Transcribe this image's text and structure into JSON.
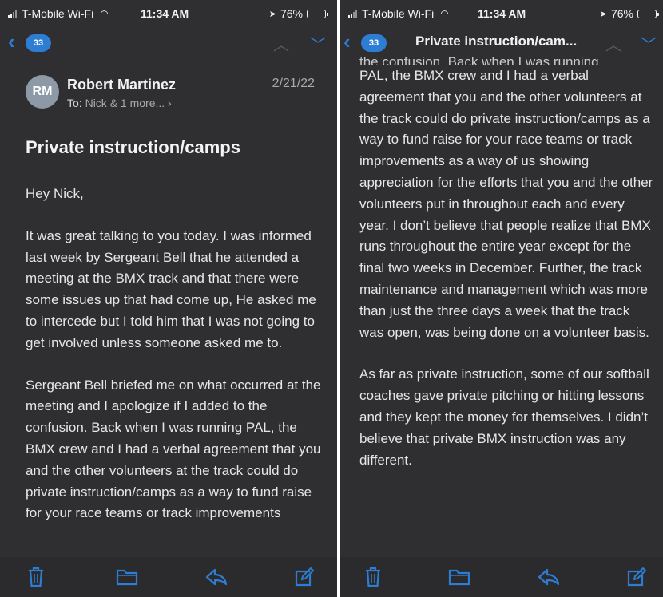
{
  "colors": {
    "accent": "#2d7dd2",
    "background": "#2f2f31",
    "text": "#e6e6e8",
    "secondary_text": "#a8a8ad",
    "avatar": "#8e99a8"
  },
  "status_bar": {
    "carrier": "T-Mobile Wi-Fi",
    "time": "11:34 AM",
    "battery": "76%",
    "battery_level": 0.76
  },
  "nav": {
    "back_count": "33",
    "title_truncated": "Private instruction/cam..."
  },
  "message": {
    "avatar_initials": "RM",
    "sender": "Robert Martinez",
    "to_label": "To:",
    "recipients": "Nick & 1 more... ›",
    "date": "2/21/22",
    "subject": "Private instruction/camps",
    "left_paragraphs": [
      "Hey Nick,",
      "It was great talking to you today. I was informed last week by Sergeant Bell that he attended a meeting at the BMX track and that there were some issues up that had come up, He asked me to intercede but I told him that I was not going to get involved unless someone asked me to.",
      "Sergeant Bell briefed me on what occurred at the meeting and I apologize if I added to the confusion. Back when I was running PAL, the BMX crew and I had a verbal agreement that you and the other volunteers at the track could do private instruction/camps as a way to fund raise for your race teams or track improvements"
    ],
    "right_cut_line": "the confusion. Back when I was running",
    "right_paragraphs": [
      "PAL, the BMX crew and I had a verbal agreement that you and the other volunteers at the track could do private instruction/camps as a way to fund raise for your race teams or track improvements as a way of us showing appreciation for the efforts that you and the other volunteers put in throughout each and every year. I don’t believe that people realize that BMX runs throughout the entire year except for the final two weeks in December. Further, the track maintenance and management which was more than just the three days a week that the track was open, was being done on a volunteer basis.",
      "As far as private instruction, some of our softball coaches gave private pitching or hitting lessons and they kept the money for themselves. I didn’t believe that private BMX instruction was any different."
    ]
  },
  "toolbar": {
    "icons": [
      "trash-icon",
      "folder-icon",
      "reply-icon",
      "compose-icon"
    ]
  }
}
